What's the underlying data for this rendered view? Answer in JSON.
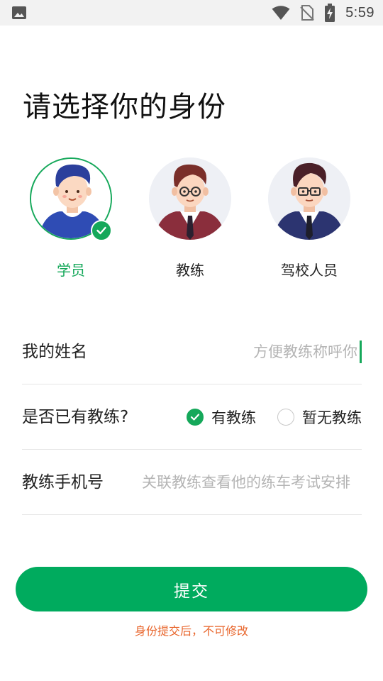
{
  "status_bar": {
    "time": "5:59",
    "icons": [
      "image-icon",
      "wifi-icon",
      "no-sim-icon",
      "battery-charging-icon"
    ]
  },
  "page": {
    "title": "请选择你的身份"
  },
  "roles": [
    {
      "label": "学员",
      "selected": true,
      "icon": "student-avatar-icon"
    },
    {
      "label": "教练",
      "selected": false,
      "icon": "coach-avatar-icon"
    },
    {
      "label": "驾校人员",
      "selected": false,
      "icon": "school-staff-avatar-icon"
    }
  ],
  "form": {
    "name": {
      "label": "我的姓名",
      "value": "",
      "placeholder": "方便教练称呼你"
    },
    "has_coach": {
      "label": "是否已有教练?",
      "options": [
        "有教练",
        "暂无教练"
      ],
      "selected": "有教练"
    },
    "coach_phone": {
      "label": "教练手机号",
      "value": "",
      "placeholder": "关联教练查看他的练车考试安排"
    }
  },
  "actions": {
    "submit_label": "提交",
    "notice": "身份提交后，不可修改"
  },
  "colors": {
    "accent": "#00ab5e",
    "selected_text": "#15a85a",
    "notice": "#e8642a",
    "status_bar_bg": "#f2f2f2"
  }
}
